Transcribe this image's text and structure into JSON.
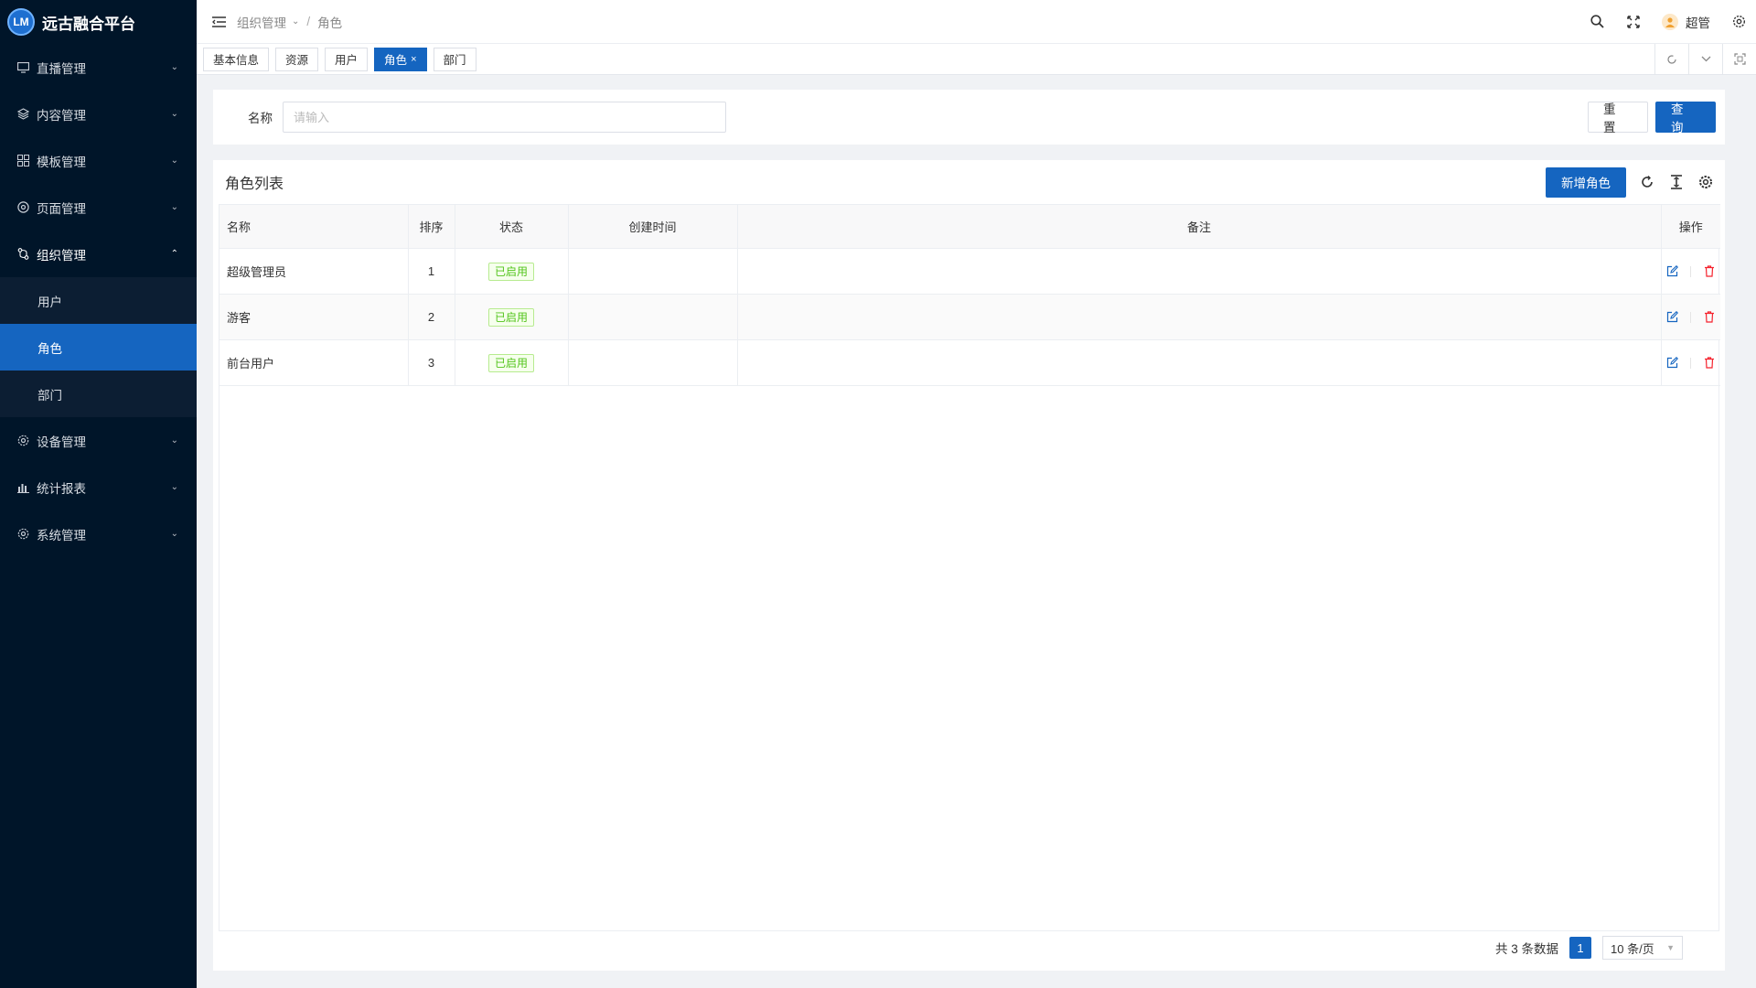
{
  "app": {
    "title": "远古融合平台",
    "logo_mark": "LM"
  },
  "sidebar": {
    "items": [
      {
        "label": "直播管理",
        "icon": "monitor-icon"
      },
      {
        "label": "内容管理",
        "icon": "layers-icon"
      },
      {
        "label": "模板管理",
        "icon": "grid-icon"
      },
      {
        "label": "页面管理",
        "icon": "compass-icon"
      },
      {
        "label": "组织管理",
        "icon": "org-icon"
      },
      {
        "label": "设备管理",
        "icon": "gear-icon"
      },
      {
        "label": "统计报表",
        "icon": "bar-chart-icon"
      },
      {
        "label": "系统管理",
        "icon": "gear-icon"
      }
    ],
    "sub_items": [
      "用户",
      "角色",
      "部门"
    ]
  },
  "header": {
    "breadcrumb": [
      "组织管理",
      "角色"
    ],
    "user_name": "超管"
  },
  "tabs": [
    {
      "label": "基本信息"
    },
    {
      "label": "资源"
    },
    {
      "label": "用户"
    },
    {
      "label": "角色"
    },
    {
      "label": "部门"
    }
  ],
  "search": {
    "label": "名称",
    "placeholder": "请输入",
    "reset_label": "重 置",
    "query_label": "查 询"
  },
  "table_panel": {
    "title": "角色列表",
    "add_label": "新增角色",
    "columns": [
      "名称",
      "排序",
      "状态",
      "创建时间",
      "备注",
      "操作"
    ],
    "rows": [
      {
        "name": "超级管理员",
        "sort": "1",
        "status": "已启用",
        "created": "",
        "remark": ""
      },
      {
        "name": "游客",
        "sort": "2",
        "status": "已启用",
        "created": "",
        "remark": ""
      },
      {
        "name": "前台用户",
        "sort": "3",
        "status": "已启用",
        "created": "",
        "remark": ""
      }
    ]
  },
  "pagination": {
    "total_text": "共 3 条数据",
    "current_page": "1",
    "page_size": "10 条/页"
  },
  "colors": {
    "sidebar_bg": "#001529",
    "primary": "#1565c0",
    "success": "#52c41a",
    "danger": "#f5222d"
  }
}
